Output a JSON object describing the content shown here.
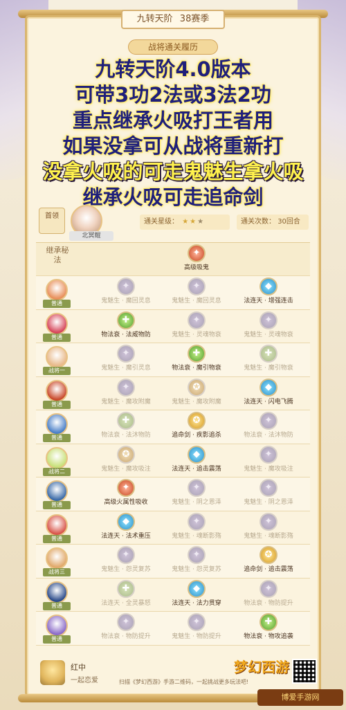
{
  "header": {
    "tier": "九转天阶",
    "season": "38赛季",
    "record_title": "战将通关履历"
  },
  "overlay_lines": [
    {
      "text": "九转天阶4.0版本",
      "style": "blue"
    },
    {
      "text": "可带3功2法或3法2功",
      "style": "blue"
    },
    {
      "text": "重点继承火吸打王者用",
      "style": "blue"
    },
    {
      "text": "如果没拿可从战将重新打",
      "style": "blue"
    },
    {
      "text": "没拿火吸的可走鬼魅生拿火吸",
      "style": "yellow"
    },
    {
      "text": "继承火吸可走追命剑",
      "style": "blue"
    }
  ],
  "hero": {
    "role": "首领",
    "name": "北冥鲲",
    "stars_label": "通关星级：",
    "stars_filled": 2,
    "stars_total": 3,
    "count_label": "通关次数：",
    "count_value": "30回合"
  },
  "table": {
    "header_label": "继承秘法",
    "header_skill": {
      "name": "高级吸鬼",
      "icon": "red"
    },
    "rows": [
      {
        "tag": "普通",
        "avatar": "#e88f5a",
        "skills": [
          {
            "name": "鬼魅生 · 魔回灵息",
            "icon": "dim",
            "dim": true
          },
          {
            "name": "鬼魅生 · 魔回灵息",
            "icon": "dim",
            "dim": true
          },
          {
            "name": "法连天 · 增强连击",
            "icon": "blue",
            "dim": false
          }
        ]
      },
      {
        "tag": "普通",
        "avatar": "#d6455a",
        "skills": [
          {
            "name": "物法衰 · 法威物防",
            "icon": "green",
            "dim": false
          },
          {
            "name": "鬼魅生 · 灵魂物衰",
            "icon": "dim",
            "dim": true
          },
          {
            "name": "鬼魅生 · 灵魂物衰",
            "icon": "dim",
            "dim": true
          }
        ]
      },
      {
        "tag": "战将一",
        "avatar": "#e8b98a",
        "skills": [
          {
            "name": "鬼魅生 · 魔引灵息",
            "icon": "dim",
            "dim": true
          },
          {
            "name": "物法衰 · 魔引物衰",
            "icon": "green",
            "dim": false
          },
          {
            "name": "鬼魅生 · 魔引物衰",
            "icon": "dimgreen",
            "dim": true
          }
        ]
      },
      {
        "tag": "普通",
        "avatar": "#c9482a",
        "skills": [
          {
            "name": "鬼魅生 · 魔攻附魔",
            "icon": "dim",
            "dim": true
          },
          {
            "name": "鬼魅生 · 魔攻附魔",
            "icon": "dimgold",
            "dim": true
          },
          {
            "name": "法连天 · 闪电飞腾",
            "icon": "blue",
            "dim": false
          }
        ]
      },
      {
        "tag": "普通",
        "avatar": "#4a7fc8",
        "skills": [
          {
            "name": "物法衰 · 法沐物防",
            "icon": "dimgreen",
            "dim": true
          },
          {
            "name": "追命剑 · 疾影追杀",
            "icon": "gold",
            "dim": false
          },
          {
            "name": "物法衰 · 法沐物防",
            "icon": "dim",
            "dim": true
          }
        ]
      },
      {
        "tag": "战将二",
        "avatar": "#c9e07a",
        "skills": [
          {
            "name": "鬼魅生 · 魔攻吸注",
            "icon": "dimgold",
            "dim": true
          },
          {
            "name": "法连天 · 追击震荡",
            "icon": "blue",
            "dim": false
          },
          {
            "name": "鬼魅生 · 魔攻吸注",
            "icon": "dim",
            "dim": true
          }
        ]
      },
      {
        "tag": "普通",
        "avatar": "#3a6aa8",
        "skills": [
          {
            "name": "高级火属性吸收",
            "icon": "red",
            "dim": false
          },
          {
            "name": "鬼魅生 · 阴之恩泽",
            "icon": "dim",
            "dim": true
          },
          {
            "name": "鬼魅生 · 阴之恩泽",
            "icon": "dim",
            "dim": true
          }
        ]
      },
      {
        "tag": "普通",
        "avatar": "#d8554a",
        "skills": [
          {
            "name": "法连天 · 法术重压",
            "icon": "blue",
            "dim": false
          },
          {
            "name": "鬼魅生 · 魂断影殇",
            "icon": "dim",
            "dim": true
          },
          {
            "name": "鬼魅生 · 魂断影殇",
            "icon": "dim",
            "dim": true
          }
        ]
      },
      {
        "tag": "战将三",
        "avatar": "#e0a86a",
        "skills": [
          {
            "name": "鬼魅生 · 怨灵复苏",
            "icon": "dim",
            "dim": true
          },
          {
            "name": "鬼魅生 · 怨灵复苏",
            "icon": "dim",
            "dim": true
          },
          {
            "name": "追命剑 · 追击震荡",
            "icon": "gold",
            "dim": false
          }
        ]
      },
      {
        "tag": "普通",
        "avatar": "#2a4a8a",
        "skills": [
          {
            "name": "法连天 · 全灵暴怒",
            "icon": "dimgreen",
            "dim": true
          },
          {
            "name": "法连天 · 法力贯穿",
            "icon": "blue",
            "dim": false
          },
          {
            "name": "物法衰 · 物防提升",
            "icon": "dim",
            "dim": true
          }
        ]
      },
      {
        "tag": "普通",
        "avatar": "#8a6ac8",
        "skills": [
          {
            "name": "物法衰 · 物防提升",
            "icon": "dim",
            "dim": true
          },
          {
            "name": "鬼魅生 · 物防提升",
            "icon": "dim",
            "dim": true
          },
          {
            "name": "物法衰 · 物攻追袭",
            "icon": "green",
            "dim": false
          }
        ]
      }
    ]
  },
  "footer": {
    "name": "红中",
    "subtitle": "一起恋爱",
    "logo_text": "梦幻西游",
    "note": "扫描《梦幻西游》手游二维码，一起挑战更多玩法吧!",
    "watermark": "博爱手游网"
  }
}
